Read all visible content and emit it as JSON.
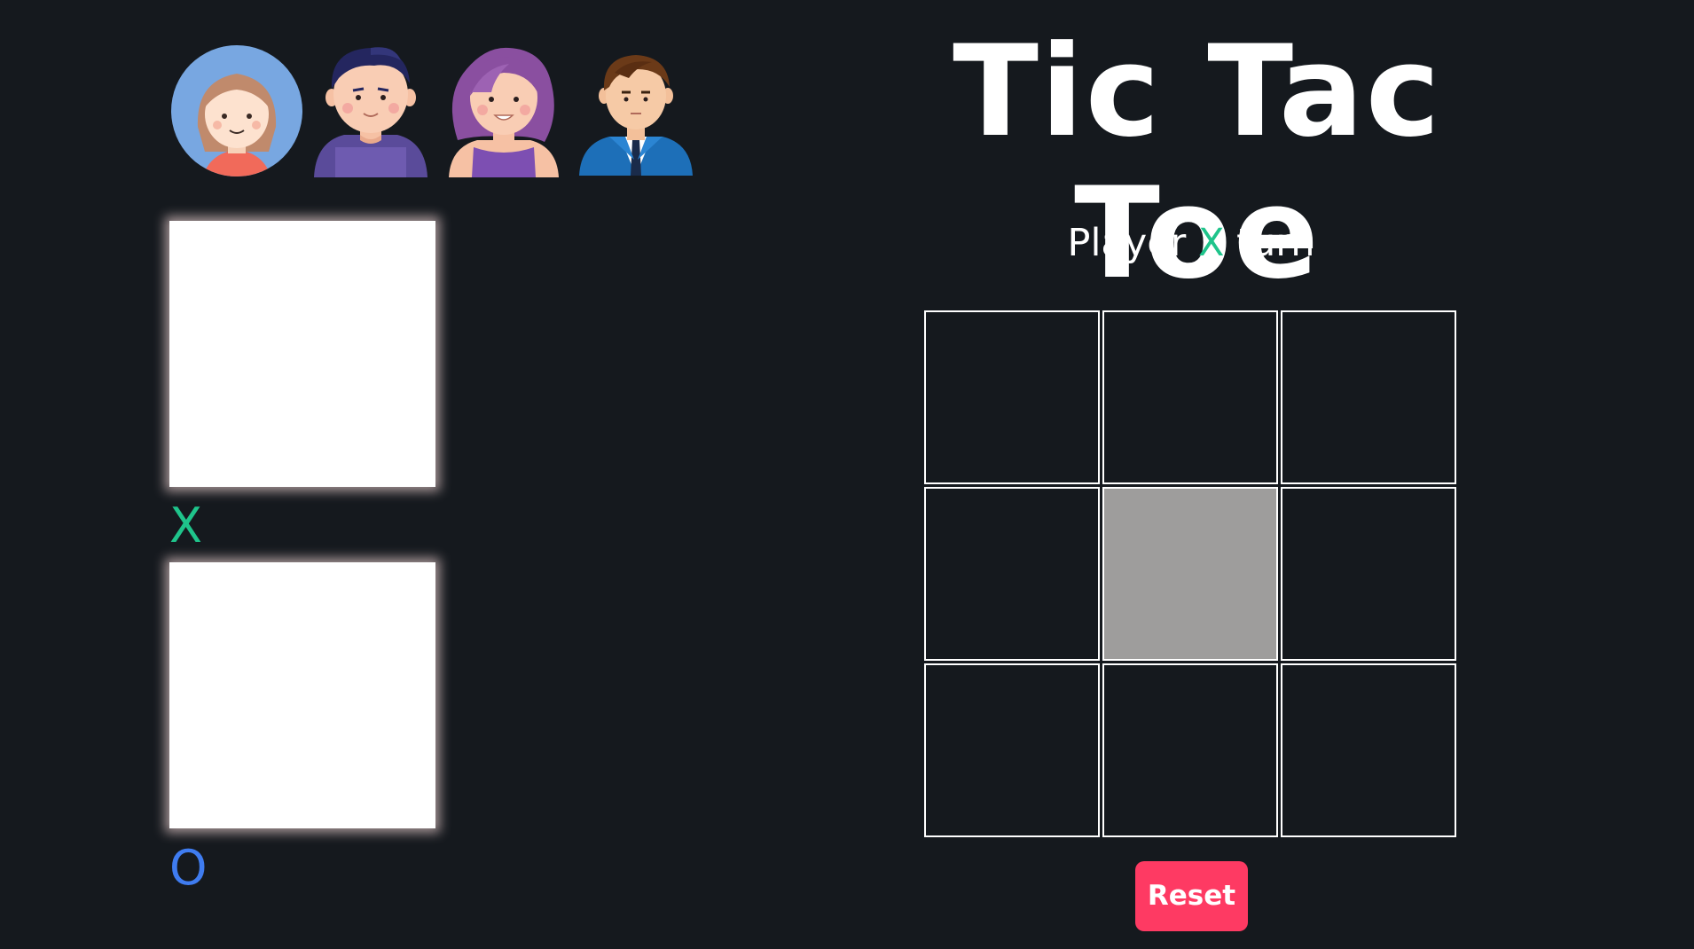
{
  "title": "Tic Tac Toe",
  "status": {
    "prefix": "Player",
    "current_player": "X",
    "suffix": "turn",
    "current_player_color": "#1fc48b"
  },
  "avatars": [
    {
      "icon": "girl-avatar-icon"
    },
    {
      "icon": "man-avatar-icon"
    },
    {
      "icon": "woman-avatar-icon"
    },
    {
      "icon": "businessman-avatar-icon"
    }
  ],
  "players": [
    {
      "mark": "X",
      "color": "#1fc48b"
    },
    {
      "mark": "O",
      "color": "#3f7cf0"
    }
  ],
  "board": {
    "cells": [
      "",
      "",
      "",
      "",
      "",
      "",
      "",
      "",
      ""
    ],
    "hovered_cell": 4
  },
  "reset_label": "Reset",
  "colors": {
    "background": "#15191e",
    "reset_button": "#fe3a63",
    "hover_cell": "#9e9d9c"
  }
}
